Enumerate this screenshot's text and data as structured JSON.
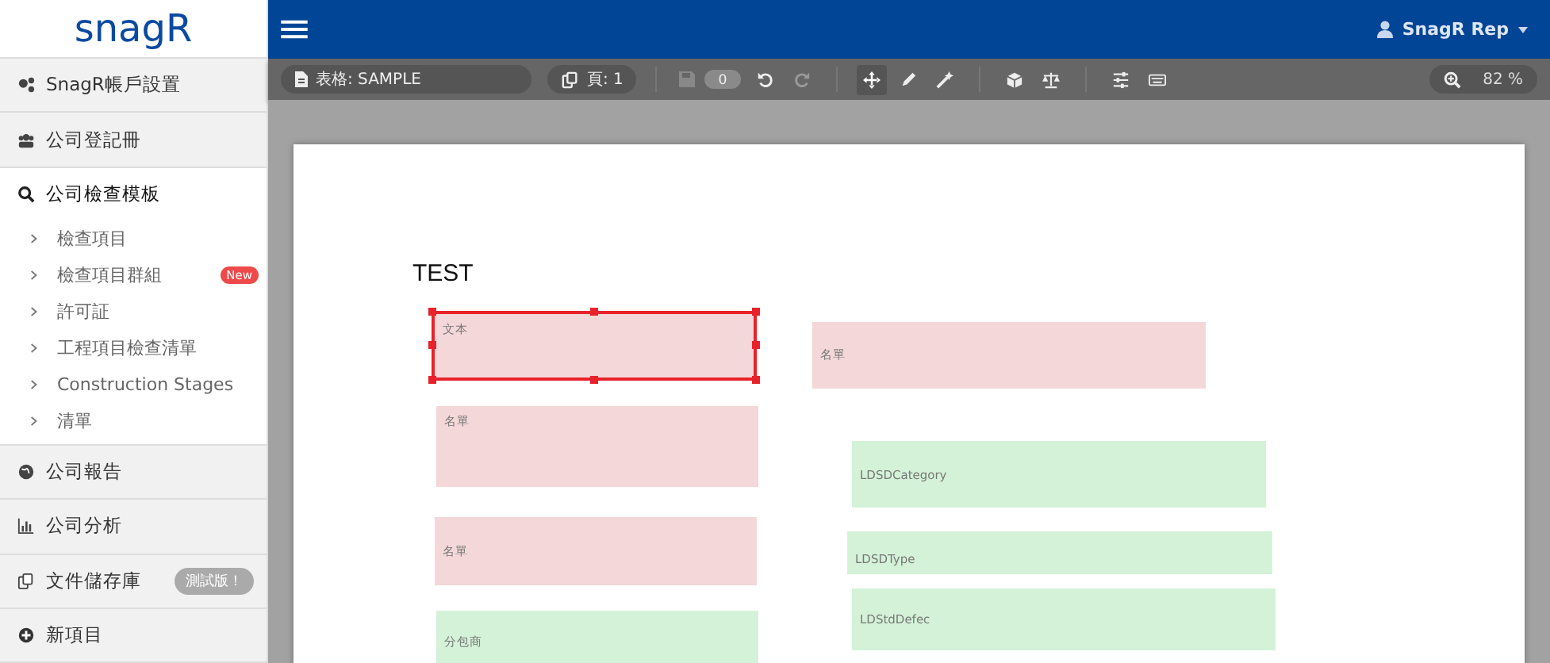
{
  "logo": "snagR",
  "user": {
    "name": "SnagR Rep"
  },
  "sidebar": {
    "items": [
      {
        "label": "SnagR帳戶設置",
        "selected": false
      },
      {
        "label": "公司登記冊",
        "selected": false
      },
      {
        "label": "公司檢查模板",
        "selected": true,
        "children": [
          {
            "label": "檢查項目"
          },
          {
            "label": "檢查項目群組",
            "badge": "New"
          },
          {
            "label": "許可証"
          },
          {
            "label": "工程項目檢查清單"
          },
          {
            "label": "Construction Stages"
          },
          {
            "label": "清單"
          }
        ]
      },
      {
        "label": "公司報告",
        "selected": false
      },
      {
        "label": "公司分析",
        "selected": false
      },
      {
        "label": "文件儲存庫",
        "selected": false,
        "badge": "測試版！"
      },
      {
        "label": "新項目",
        "selected": false
      }
    ]
  },
  "toolbar": {
    "form": "表格: SAMPLE",
    "page": "頁: 1",
    "save": {
      "count": "0",
      "disabled": true
    },
    "tools": [
      {
        "kind": "undo",
        "selected": false,
        "disabled": false
      },
      {
        "kind": "redo",
        "selected": false,
        "disabled": true
      },
      {
        "kind": "move",
        "selected": true,
        "disabled": false
      },
      {
        "kind": "pencil",
        "selected": false,
        "disabled": false
      },
      {
        "kind": "wand",
        "selected": false,
        "disabled": false
      },
      {
        "kind": "cube",
        "selected": false,
        "disabled": false
      },
      {
        "kind": "scale",
        "selected": false,
        "disabled": false
      },
      {
        "kind": "sliders",
        "selected": false,
        "disabled": false
      },
      {
        "kind": "keyboard",
        "selected": false,
        "disabled": false
      }
    ],
    "zoom": "82 %"
  },
  "page": {
    "title": "TEST",
    "fields": [
      {
        "label": "文本",
        "color": "#f4d7d8",
        "selected": true
      },
      {
        "label": "名單",
        "color": "#f4d7d8",
        "selected": false
      },
      {
        "label": "名單",
        "color": "#f4d7d8",
        "selected": false
      },
      {
        "label": "名單",
        "color": "#f4d7d8",
        "selected": false
      },
      {
        "label": "分包商",
        "color": "#d4f2d8",
        "selected": false
      },
      {
        "label": "LDSDCategory",
        "color": "#d4f2d8",
        "selected": false
      },
      {
        "label": "LDSDType",
        "color": "#d4f2d8",
        "selected": false
      },
      {
        "label": "LDStdDefec",
        "color": "#d4f2d8",
        "selected": false
      }
    ]
  }
}
